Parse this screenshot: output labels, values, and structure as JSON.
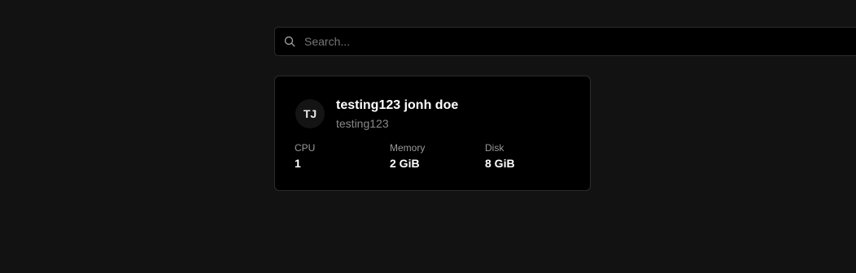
{
  "search": {
    "placeholder": "Search...",
    "value": ""
  },
  "server_card": {
    "avatar_initials": "TJ",
    "name": "testing123 jonh doe",
    "id": "testing123",
    "stats": [
      {
        "label": "CPU",
        "value": "1"
      },
      {
        "label": "Memory",
        "value": "2 GiB"
      },
      {
        "label": "Disk",
        "value": "8 GiB"
      }
    ]
  },
  "colors": {
    "background": "#121212",
    "surface": "#000000",
    "border": "#2c2c2c",
    "muted_text": "#8a8a8a"
  },
  "icons": {
    "search": "search-icon"
  }
}
